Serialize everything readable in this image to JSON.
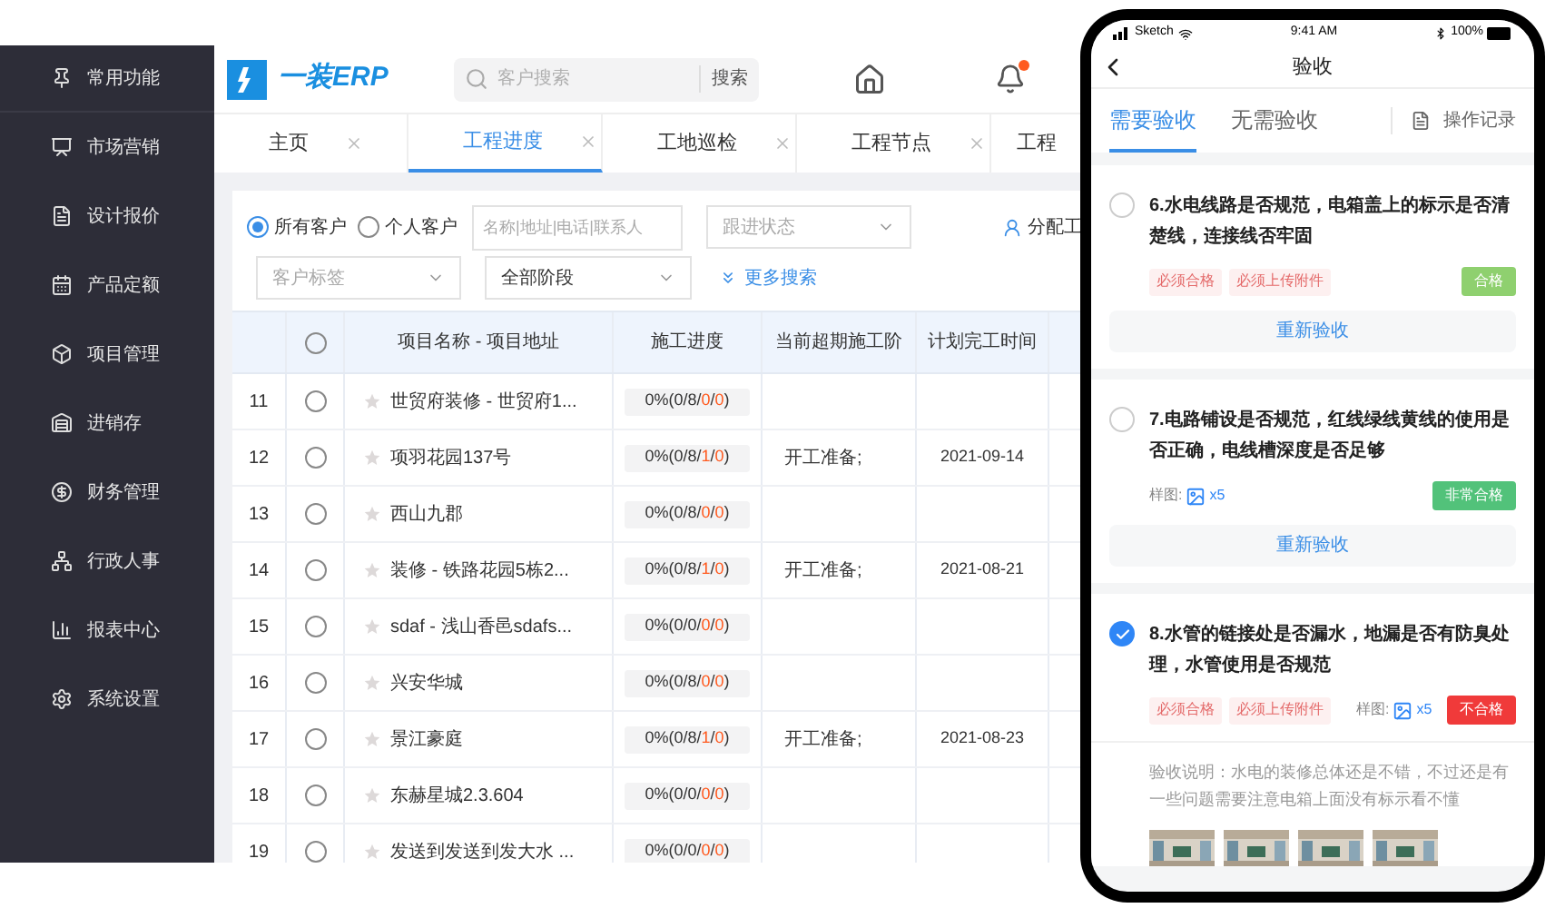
{
  "sidebar": {
    "items": [
      {
        "label": "常用功能"
      },
      {
        "label": "市场营销"
      },
      {
        "label": "设计报价"
      },
      {
        "label": "产品定额"
      },
      {
        "label": "项目管理"
      },
      {
        "label": "进销存"
      },
      {
        "label": "财务管理"
      },
      {
        "label": "行政人事"
      },
      {
        "label": "报表中心"
      },
      {
        "label": "系统设置"
      }
    ]
  },
  "header": {
    "logo": "一装ERP",
    "search": {
      "placeholder": "客户搜索",
      "button": "搜索"
    }
  },
  "tabs": [
    {
      "label": "主页",
      "selected": false
    },
    {
      "label": "工程进度",
      "selected": true
    },
    {
      "label": "工地巡检",
      "selected": false
    },
    {
      "label": "工程节点",
      "selected": false
    },
    {
      "label": "工程",
      "selected": false
    }
  ],
  "filters": {
    "scope": [
      {
        "label": "所有客户",
        "selected": true
      },
      {
        "label": "个人客户",
        "selected": false
      }
    ],
    "keyword": {
      "placeholder": "名称|地址|电话|联系人"
    },
    "follow_status": {
      "placeholder": "跟进状态"
    },
    "assign_link": "分配工",
    "customer_tag": {
      "placeholder": "客户标签"
    },
    "stage": {
      "value": "全部阶段"
    },
    "more_search": "更多搜索"
  },
  "table": {
    "select_all": false,
    "columns": [
      "项目名称 - 项目地址",
      "施工进度",
      "当前超期施工阶",
      "计划完工时间"
    ],
    "rows": [
      {
        "index": "11",
        "selected": false,
        "name": "世贸府装修 - 世贸府1...",
        "progress": [
          {
            "text": "0%(0/8/",
            "alert": false
          },
          {
            "text": "0",
            "alert": true
          },
          {
            "text": "/",
            "alert": false
          },
          {
            "text": "0",
            "alert": true
          },
          {
            "text": ")",
            "alert": false
          }
        ]
      },
      {
        "index": "12",
        "selected": false,
        "name": "项羽花园137号",
        "progress": [
          {
            "text": "0%(0/8/",
            "alert": false
          },
          {
            "text": "1",
            "alert": true
          },
          {
            "text": "/",
            "alert": false
          },
          {
            "text": "0",
            "alert": true
          },
          {
            "text": ")",
            "alert": false
          }
        ],
        "stage": "开工准备;",
        "planned": "2021-09-14"
      },
      {
        "index": "13",
        "selected": false,
        "name": "西山九郡",
        "progress": [
          {
            "text": "0%(0/8/",
            "alert": false
          },
          {
            "text": "0",
            "alert": true
          },
          {
            "text": "/",
            "alert": false
          },
          {
            "text": "0",
            "alert": true
          },
          {
            "text": ")",
            "alert": false
          }
        ]
      },
      {
        "index": "14",
        "selected": false,
        "name": "装修 - 铁路花园5栋2...",
        "progress": [
          {
            "text": "0%(0/8/",
            "alert": false
          },
          {
            "text": "1",
            "alert": true
          },
          {
            "text": "/",
            "alert": false
          },
          {
            "text": "0",
            "alert": true
          },
          {
            "text": ")",
            "alert": false
          }
        ],
        "stage": "开工准备;",
        "planned": "2021-08-21"
      },
      {
        "index": "15",
        "selected": false,
        "name": "sdaf - 浅山香邑sdafs...",
        "progress": [
          {
            "text": "0%(0/0/",
            "alert": false
          },
          {
            "text": "0",
            "alert": true
          },
          {
            "text": "/",
            "alert": false
          },
          {
            "text": "0",
            "alert": true
          },
          {
            "text": ")",
            "alert": false
          }
        ]
      },
      {
        "index": "16",
        "selected": false,
        "name": "兴安华城",
        "progress": [
          {
            "text": "0%(0/8/",
            "alert": false
          },
          {
            "text": "0",
            "alert": true
          },
          {
            "text": "/",
            "alert": false
          },
          {
            "text": "0",
            "alert": true
          },
          {
            "text": ")",
            "alert": false
          }
        ]
      },
      {
        "index": "17",
        "selected": false,
        "name": "景江豪庭",
        "progress": [
          {
            "text": "0%(0/8/",
            "alert": false
          },
          {
            "text": "1",
            "alert": true
          },
          {
            "text": "/",
            "alert": false
          },
          {
            "text": "0",
            "alert": true
          },
          {
            "text": ")",
            "alert": false
          }
        ],
        "stage": "开工准备;",
        "planned": "2021-08-23"
      },
      {
        "index": "18",
        "selected": false,
        "name": "东赫星城2.3.604",
        "progress": [
          {
            "text": "0%(0/0/",
            "alert": false
          },
          {
            "text": "0",
            "alert": true
          },
          {
            "text": "/",
            "alert": false
          },
          {
            "text": "0",
            "alert": true
          },
          {
            "text": ")",
            "alert": false
          }
        ]
      },
      {
        "index": "19",
        "selected": false,
        "name": "发送到发送到发大水 ...",
        "progress": [
          {
            "text": "0%(0/0/",
            "alert": false
          },
          {
            "text": "0",
            "alert": true
          },
          {
            "text": "/",
            "alert": false
          },
          {
            "text": "0",
            "alert": true
          },
          {
            "text": ")",
            "alert": false
          }
        ]
      }
    ]
  },
  "phone": {
    "status_bar": {
      "carrier": "Sketch",
      "time": "9:41 AM",
      "battery": "100%"
    },
    "title": "验收",
    "tabs": [
      {
        "label": "需要验收",
        "selected": true
      },
      {
        "label": "无需验收",
        "selected": false
      }
    ],
    "log_link": "操作记录",
    "items": [
      {
        "checked": false,
        "question": "6.水电线路是否规范，电箱盖上的标示是否清楚线，连接线否牢固",
        "tags": [
          "必须合格",
          "必须上传附件"
        ],
        "result": "合格",
        "color": "#8fd06f",
        "recheck": "重新验收"
      },
      {
        "checked": false,
        "question": "7.电路铺设是否规范，红线绿线黄线的使用是否正确，电线槽深度是否足够",
        "sample_label": "样图:",
        "sample_count": "x5",
        "result": "非常合格",
        "color": "#52c27a",
        "recheck": "重新验收"
      },
      {
        "checked": true,
        "question": "8.水管的链接处是否漏水，地漏是否有防臭处理，水管使用是否规范",
        "tags": [
          "必须合格",
          "必须上传附件"
        ],
        "sample_label": "样图:",
        "sample_count": "x5",
        "result": "不合格",
        "color": "#f03a3a",
        "note": "验收说明：水电的装修总体还是不错，不过还是有一些问题需要注意电箱上面没有标示看不懂",
        "photos": [
          {
            "kind": "picture"
          },
          {
            "kind": "picture"
          },
          {
            "kind": "picture"
          },
          {
            "kind": "picture"
          }
        ]
      }
    ]
  }
}
